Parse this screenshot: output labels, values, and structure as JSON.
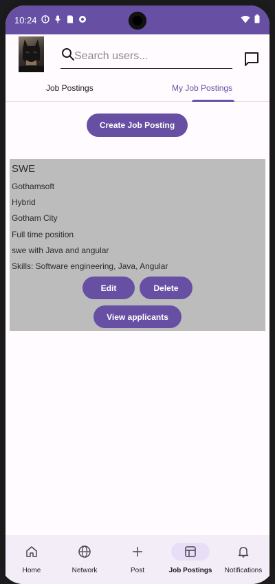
{
  "status_bar": {
    "time": "10:24",
    "left_icons": [
      "info-icon",
      "mic-icon",
      "sim-icon",
      "data-saver-icon"
    ],
    "right_icons": [
      "wifi-icon",
      "battery-icon"
    ]
  },
  "header": {
    "search_placeholder": "Search users...",
    "search_value": ""
  },
  "tabs": [
    {
      "label": "Job Postings",
      "active": false
    },
    {
      "label": "My Job Postings",
      "active": true
    }
  ],
  "create_button_label": "Create Job Posting",
  "job_card": {
    "title": "SWE",
    "company": "Gothamsoft",
    "work_mode": "Hybrid",
    "location": "Gotham City",
    "employment_type": "Full time position",
    "description": "swe with Java and angular",
    "skills": "Skills: Software engineering, Java, Angular",
    "edit_label": "Edit",
    "delete_label": "Delete",
    "view_applicants_label": "View applicants"
  },
  "bottom_nav": [
    {
      "label": "Home",
      "icon": "home-icon",
      "active": false
    },
    {
      "label": "Network",
      "icon": "globe-icon",
      "active": false
    },
    {
      "label": "Post",
      "icon": "plus-icon",
      "active": false
    },
    {
      "label": "Job Postings",
      "icon": "job-board-icon",
      "active": true
    },
    {
      "label": "Notifications",
      "icon": "bell-icon",
      "active": false
    }
  ],
  "colors": {
    "primary": "#6750a4",
    "card_background": "#bcbcbc",
    "nav_background": "#f3edf7",
    "nav_active_pill": "#e8def8"
  }
}
